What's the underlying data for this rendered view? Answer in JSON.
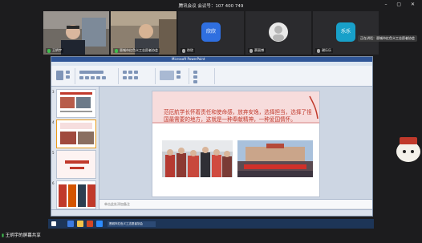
{
  "meeting": {
    "title": "腾讯会议 会议号：107 400 749",
    "share_label": "王炳宇的屏幕共享"
  },
  "participants": [
    {
      "name": "王炳宇",
      "type": "video"
    },
    {
      "name": "晋城市红色义工志愿者协会",
      "type": "video"
    },
    {
      "name": "徐欣",
      "avatar_text": "欣欣",
      "avatar_color": "#2f6fe0"
    },
    {
      "name": "蔡丽博",
      "avatar_text": "",
      "avatar_color": "#ffffff"
    },
    {
      "name": "谢乐乐",
      "avatar_text": "乐乐",
      "avatar_color": "#18a0c9"
    }
  ],
  "speaking_tip": "正在讲话：晋城市红色义工志愿者协会",
  "ppt": {
    "title": "Microsoft PowerPoint",
    "slide_text": "范厄航学长怀着责任和使命感，放弃安逸，选择担当，选择了祖国最需要的地方，这就是一种奉献精神，一种爱国情怀。",
    "notes_placeholder": "单击此处添加备注",
    "thumb_numbers": [
      "3",
      "4",
      "5",
      "6"
    ]
  },
  "taskbar": {
    "app_label": "晋城市红色义工志愿者协会"
  },
  "colors": {
    "bg": "#1c1c1e",
    "ppt_accent": "#2f5597",
    "slide_text": "#c0392b",
    "taskbar": "#1d3557"
  }
}
